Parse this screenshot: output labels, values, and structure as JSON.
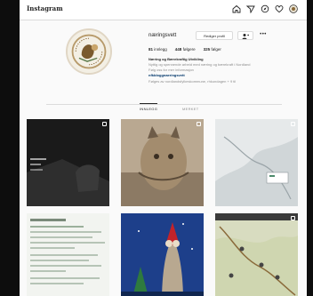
{
  "nav": {
    "logo": "Instagram",
    "icons": [
      "home-icon",
      "direct-icon",
      "explore-icon",
      "heart-icon",
      "profile-avatar-icon"
    ]
  },
  "profile": {
    "username": "næringsvett",
    "edit_label": "Rediger profil",
    "stats": [
      {
        "count": "81",
        "label": "innlegg"
      },
      {
        "count": "448",
        "label": "følgere"
      },
      {
        "count": "325",
        "label": "følger"
      }
    ],
    "display_name": "Næring og Bærekraftig Utvikling",
    "bio_line1": "Nyttig og spennende arbeid med næring og bærekraft i Nordland",
    "bio_line2": "Følg oss for mer informasjon",
    "link": "nfkbloggnaeringsvett",
    "followed_by": "Følges av nordlandsfylkeskommune, rhkundagen + 9 til"
  },
  "tabs": [
    {
      "label": "Innlegg",
      "active": true
    },
    {
      "label": "Merket",
      "active": false
    }
  ],
  "colors": {
    "background": "#fafafa",
    "text": "#262626",
    "muted": "#8e8e8e",
    "link": "#00376b",
    "border": "#dbdbdb"
  }
}
